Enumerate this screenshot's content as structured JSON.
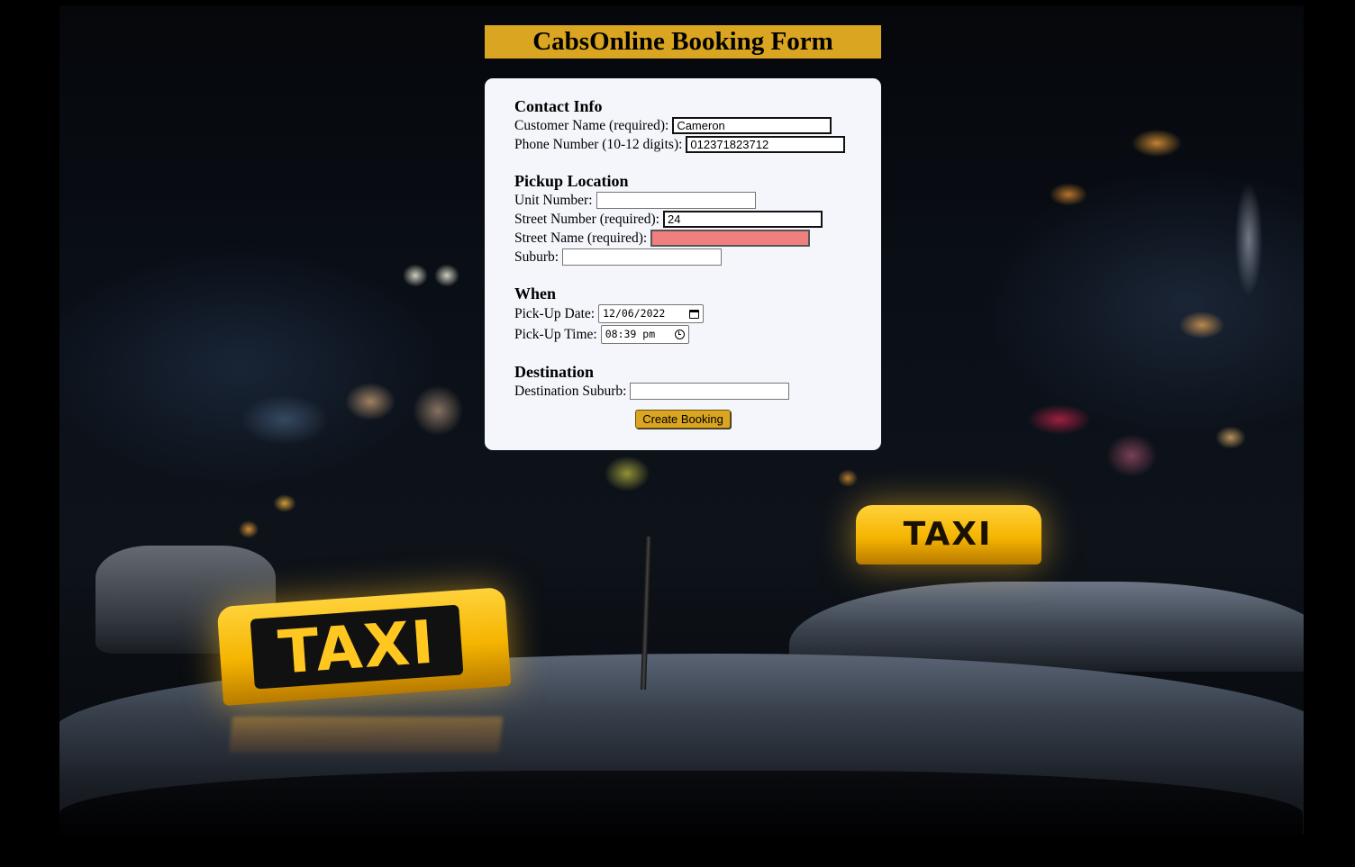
{
  "page": {
    "title": "CabsOnline Booking Form"
  },
  "background": {
    "sign_text": "TAXI"
  },
  "form": {
    "contact": {
      "heading": "Contact Info",
      "customer_name_label": "Customer Name (required):",
      "customer_name_value": "Cameron",
      "phone_label": "Phone Number (10-12 digits):",
      "phone_value": "012371823712"
    },
    "pickup": {
      "heading": "Pickup Location",
      "unit_label": "Unit Number:",
      "unit_value": "",
      "street_number_label": "Street Number (required):",
      "street_number_value": "24",
      "street_name_label": "Street Name (required):",
      "street_name_value": "",
      "suburb_label": "Suburb:",
      "suburb_value": ""
    },
    "when": {
      "heading": "When",
      "date_label": "Pick-Up Date:",
      "date_value": "12/06/2022",
      "time_label": "Pick-Up Time:",
      "time_value": "08:39 pm"
    },
    "destination": {
      "heading": "Destination",
      "suburb_label": "Destination Suburb:",
      "suburb_value": ""
    },
    "submit_label": "Create Booking"
  },
  "colors": {
    "accent": "#daa520",
    "invalid_field": "#f08080",
    "card_background": "#f4f6fc"
  },
  "icons": {
    "date": "calendar-icon",
    "time": "clock-icon"
  }
}
